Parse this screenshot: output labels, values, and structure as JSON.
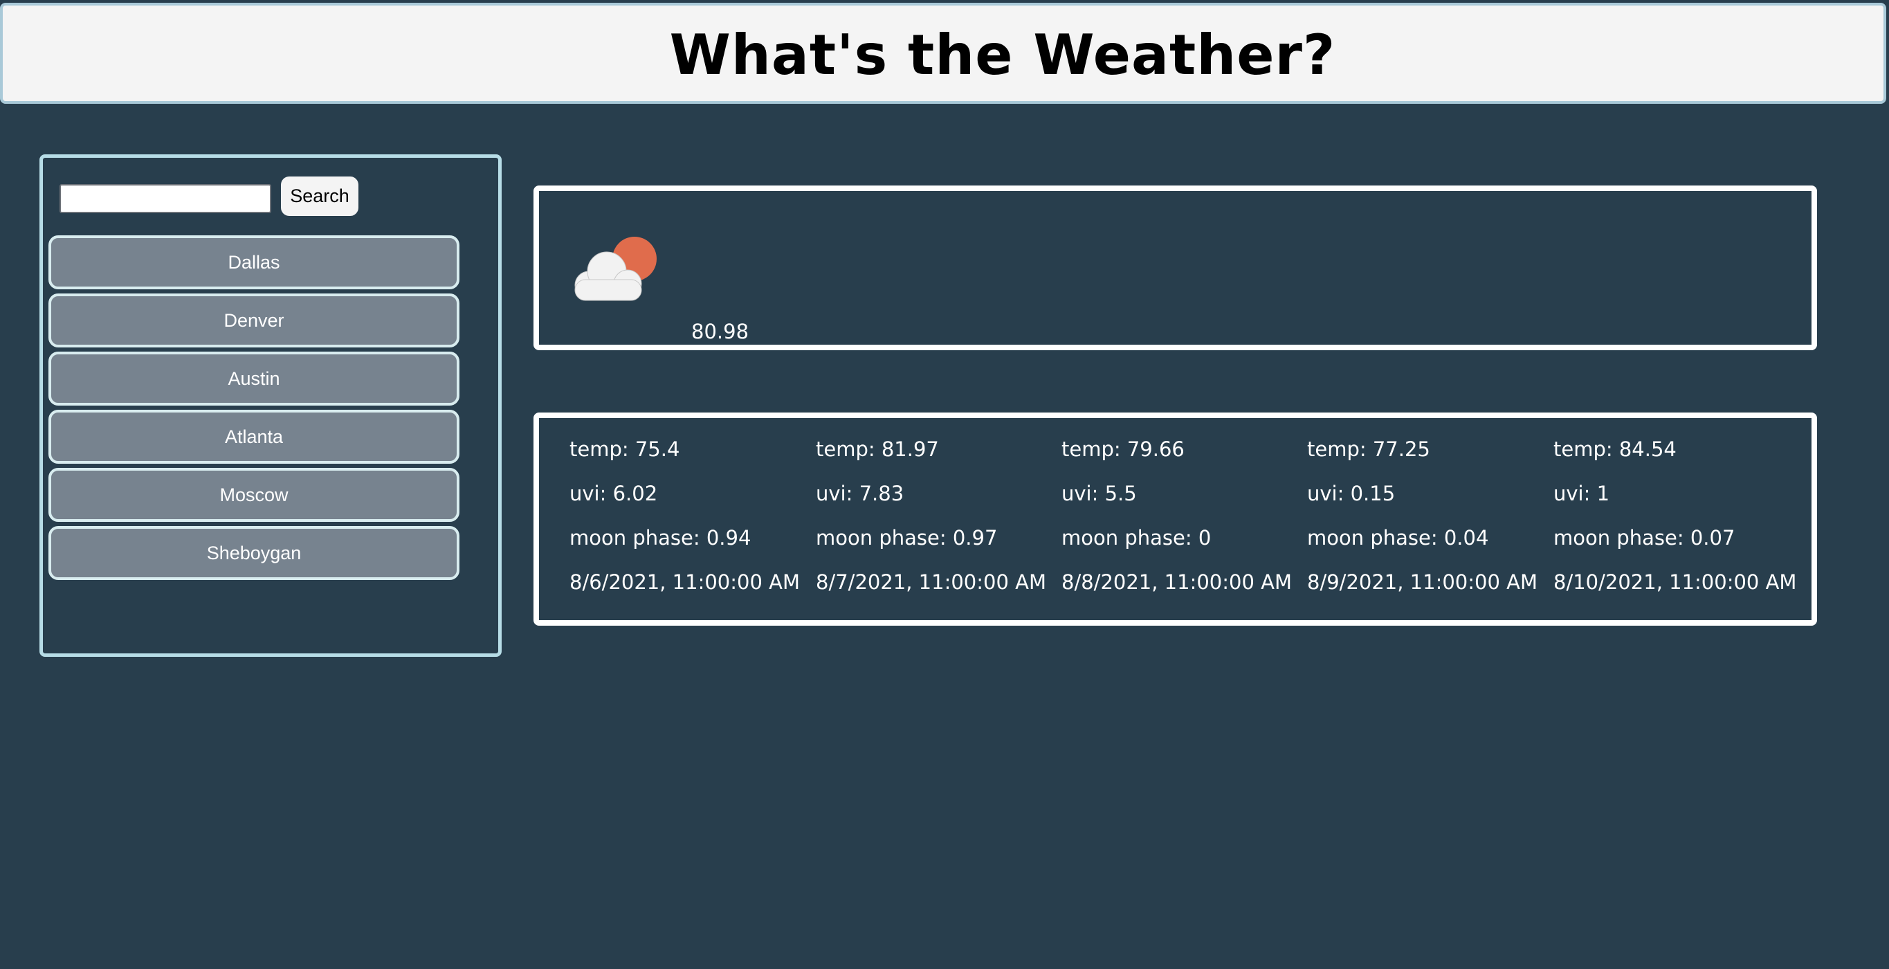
{
  "header": {
    "title": "What's the Weather?"
  },
  "sidebar": {
    "search": {
      "value": "",
      "placeholder": "",
      "button_label": "Search"
    },
    "cities": [
      "Dallas",
      "Denver",
      "Austin",
      "Atlanta",
      "Moscow",
      "Sheboygan"
    ]
  },
  "current": {
    "icon": "cloud-sun-icon",
    "temp": "80.98"
  },
  "forecast": [
    {
      "temp": "temp: 75.4",
      "uvi": "uvi: 6.02",
      "moon": "moon phase: 0.94",
      "date": "8/6/2021, 11:00:00 AM"
    },
    {
      "temp": "temp: 81.97",
      "uvi": "uvi: 7.83",
      "moon": "moon phase: 0.97",
      "date": "8/7/2021, 11:00:00 AM"
    },
    {
      "temp": "temp: 79.66",
      "uvi": "uvi: 5.5",
      "moon": "moon phase: 0",
      "date": "8/8/2021, 11:00:00 AM"
    },
    {
      "temp": "temp: 77.25",
      "uvi": "uvi: 0.15",
      "moon": "moon phase: 0.04",
      "date": "8/9/2021, 11:00:00 AM"
    },
    {
      "temp": "temp: 84.54",
      "uvi": "uvi: 1",
      "moon": "moon phase: 0.07",
      "date": "8/10/2021, 11:00:00 AM"
    }
  ],
  "colors": {
    "background": "#283e4d",
    "header_background": "#f4f4f4",
    "city_button": "#77838f",
    "sun": "#e06c4c",
    "cloud": "#f2f2f2"
  }
}
